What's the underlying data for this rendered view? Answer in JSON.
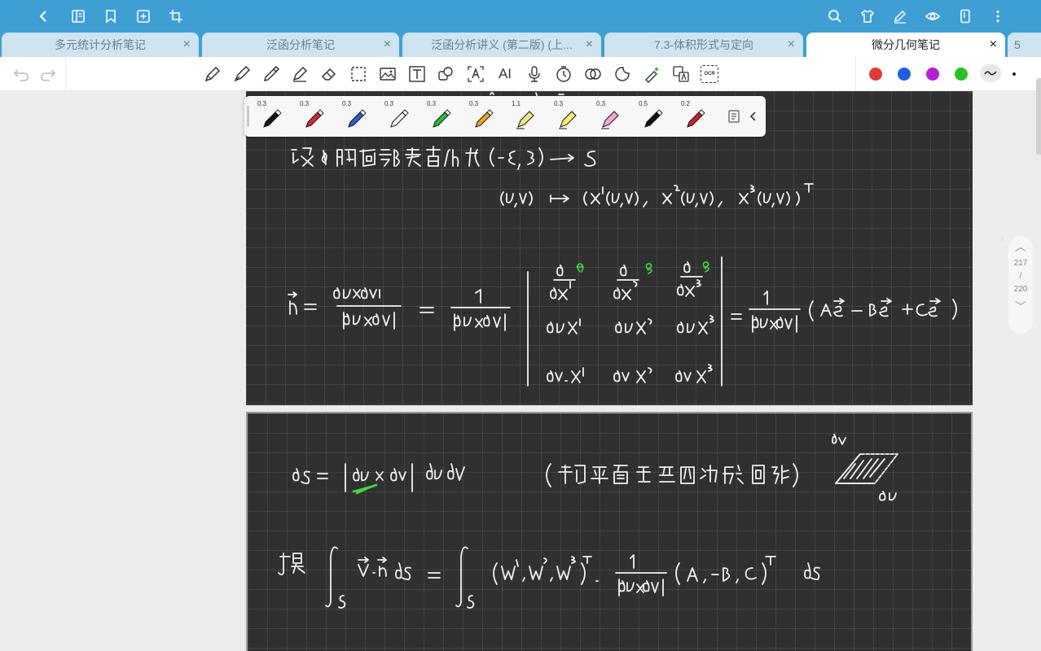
{
  "topbar": {
    "icons": [
      "back-icon",
      "book-icon",
      "bookmark-icon",
      "add-page-icon",
      "crop-icon",
      "search-icon",
      "shirt-icon",
      "pen-edit-icon",
      "eye-icon",
      "phone-icon",
      "more-vertical-icon"
    ]
  },
  "tabs": [
    {
      "label": "多元统计分析笔记",
      "active": false
    },
    {
      "label": "泛函分析笔记",
      "active": false
    },
    {
      "label": "泛函分析讲义 (第二版) (上...",
      "active": false
    },
    {
      "label": "7.3-体积形式与定向",
      "active": false
    },
    {
      "label": "微分几何笔记",
      "active": true
    }
  ],
  "tab_close": "×",
  "tab_more_count": "5",
  "toolbar": {
    "undo": "undo-icon",
    "redo": "redo-icon",
    "tools": [
      "pencil-icon",
      "fountain-pen-icon",
      "marker-icon",
      "highlighter-icon",
      "eraser-icon",
      "lasso-icon",
      "image-icon",
      "text-box-icon",
      "shape-icon",
      "text-recognize-icon",
      "ai-icon",
      "microphone-icon",
      "timer-icon",
      "link-icon",
      "sticker-icon",
      "laser-pointer-icon",
      "translate-icon",
      "ocr-icon"
    ],
    "ai_label": "AI",
    "ocr_label": "OCR",
    "colors": [
      "#e53935",
      "#1e5ee6",
      "#b81dd6",
      "#22c51f"
    ]
  },
  "pen_palette": {
    "pens": [
      {
        "width": "0.3",
        "color": "#111111"
      },
      {
        "width": "0.3",
        "color": "#d8262f"
      },
      {
        "width": "0.3",
        "color": "#1f63d8"
      },
      {
        "width": "0.3",
        "color": "#f2f2f2"
      },
      {
        "width": "0.3",
        "color": "#1fc13a"
      },
      {
        "width": "0.3",
        "color": "#f2a21a"
      },
      {
        "width": "1.1",
        "color": "#f3e97a"
      },
      {
        "width": "0.3",
        "color": "#f4ec6e"
      },
      {
        "width": "0.3",
        "color": "#f2a4d8"
      },
      {
        "width": "0.5",
        "color": "#111111"
      },
      {
        "width": "0.2",
        "color": "#cf1f2a"
      }
    ]
  },
  "page_nav": {
    "current": "217",
    "separator": "/",
    "total": "220"
  },
  "notes": {
    "line1": "设 S 的局部参数化为 (-ε, ε) ⟶ S",
    "line2": "(u,v) ↦ (x¹(u,v), x²(u,v), x³(u,v))ᵀ",
    "normal": "n⃗ = ∂u×∂v / |∂u×∂v| = 1/|∂u×∂v| · det[ ∂/∂x¹ e1, ∂/∂x² e2, ∂/∂x³ e3 ; ∂u x¹, ∂u x², ∂u x³ ; ∂v x¹, ∂v x², ∂v x³ ] = 1/|∂u×∂v| (A e1 − B e2 + C e3)",
    "ds": "ds = |∂u × ∂v| du dv",
    "ds_note": "(切平面上平行四边形面积)",
    "integral": "于是 ∫s V⃗·n⃗ ds = ∫s (W¹, W², W³)ᵀ · 1/|∂u×∂v| (A, −B, C)ᵀ ds",
    "sketch_labels": [
      "∂v",
      "∂u"
    ]
  }
}
